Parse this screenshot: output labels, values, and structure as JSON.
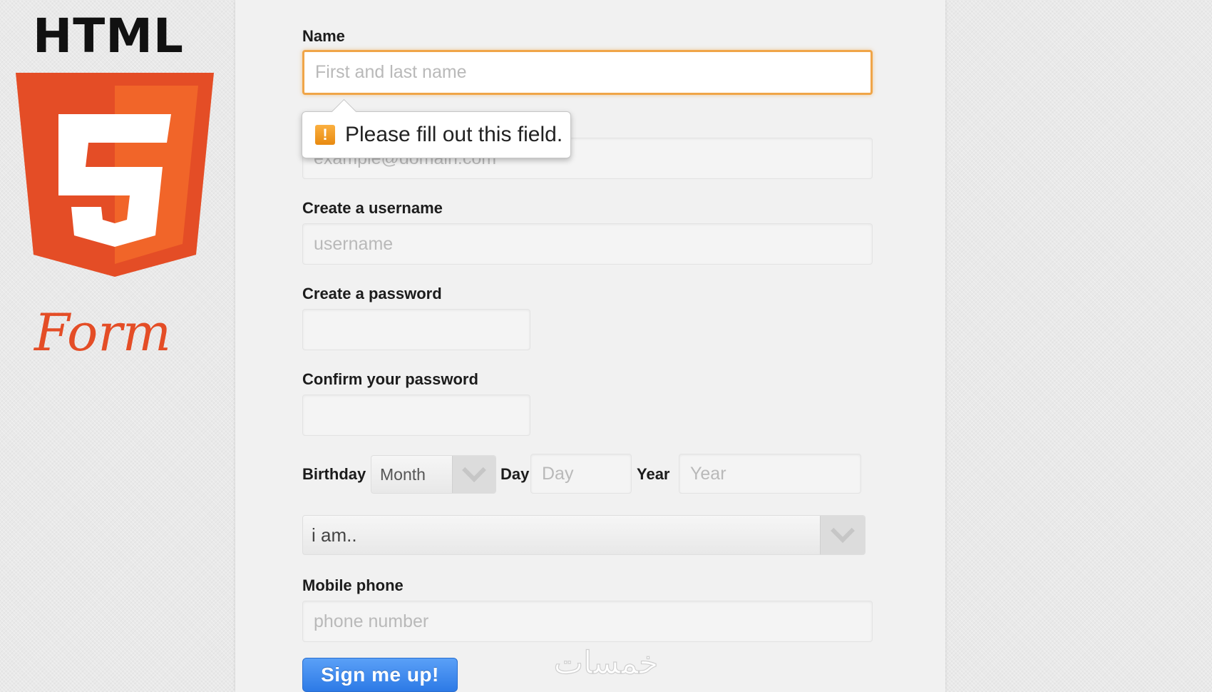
{
  "branding": {
    "html_text": "HTML",
    "badge_number": "5",
    "form_text": "Form",
    "colors": {
      "shield_dark": "#e44d26",
      "shield_light": "#f16529",
      "badge_glyph": "#ffffff",
      "form_text": "#e44d26"
    }
  },
  "form": {
    "name": {
      "label": "Name",
      "placeholder": "First and last name",
      "state": "focused"
    },
    "validation_tooltip": {
      "message": "Please fill out this field.",
      "icon": "warning-icon",
      "icon_glyph": "!"
    },
    "email": {
      "placeholder": "example@domain.com"
    },
    "username": {
      "label": "Create a username",
      "placeholder": "username"
    },
    "password": {
      "label": "Create a password"
    },
    "confirm_password": {
      "label": "Confirm your password"
    },
    "birthday": {
      "label": "Birthday",
      "month_value": "Month",
      "day_label": "Day",
      "day_placeholder": "Day",
      "year_label": "Year",
      "year_placeholder": "Year"
    },
    "gender": {
      "value": "i am.."
    },
    "mobile": {
      "label": "Mobile phone",
      "placeholder": "phone number"
    },
    "submit_label": "Sign me up!"
  },
  "watermark": {
    "text": "خمسات"
  },
  "colors": {
    "focus_border": "#f0a548",
    "submit_button": "#3d8bf0",
    "panel_background": "#f1f1f1"
  }
}
